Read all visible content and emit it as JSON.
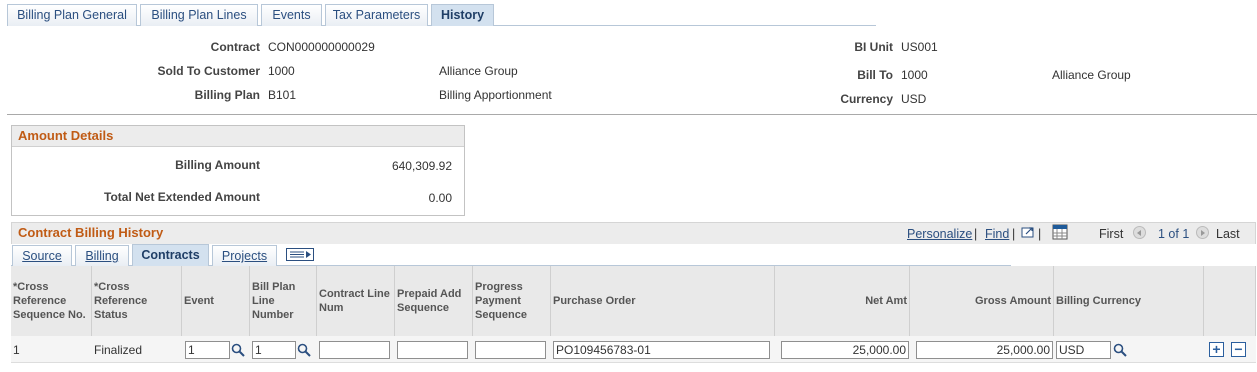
{
  "tabs": [
    "Billing Plan General",
    "Billing Plan Lines",
    "Events",
    "Tax Parameters",
    "History"
  ],
  "header": {
    "contract_label": "Contract",
    "contract_value": "CON000000000029",
    "bi_unit_label": "BI Unit",
    "bi_unit_value": "US001",
    "sold_to_label": "Sold To Customer",
    "sold_to_value": "1000",
    "sold_to_name": "Alliance Group",
    "bill_to_label": "Bill To",
    "bill_to_value": "1000",
    "bill_to_name": "Alliance Group",
    "billing_plan_label": "Billing Plan",
    "billing_plan_value": "B101",
    "billing_plan_desc": "Billing Apportionment",
    "currency_label": "Currency",
    "currency_value": "USD"
  },
  "amount_details": {
    "title": "Amount Details",
    "billing_amount_label": "Billing Amount",
    "billing_amount_value": "640,309.92",
    "total_net_label": "Total Net Extended Amount",
    "total_net_value": "0.00"
  },
  "grid": {
    "title": "Contract Billing History",
    "personalize": "Personalize",
    "find": "Find",
    "first": "First",
    "range": "1 of 1",
    "last": "Last",
    "subtabs": [
      "Source",
      "Billing",
      "Contracts",
      "Projects"
    ],
    "columns": [
      "*Cross Reference Sequence No.",
      "*Cross Reference Status",
      "Event",
      "Bill Plan Line Number",
      "Contract Line Num",
      "Prepaid Add Sequence",
      "Progress Payment Sequence",
      "Purchase Order",
      "Net Amt",
      "Gross Amount",
      "Billing Currency"
    ],
    "row": {
      "seq": "1",
      "status": "Finalized",
      "event": "1",
      "bill_plan_line": "1",
      "contract_line": "",
      "prepaid_add": "",
      "progress_payment": "",
      "purchase_order": "PO109456783-01",
      "net_amt": "25,000.00",
      "gross_amount": "25,000.00",
      "billing_currency": "USD"
    }
  },
  "colors": {
    "accent": "#c05b15",
    "link": "#2b4f80",
    "tab_active": "#d3e1ef"
  },
  "icons": [
    "lookup-icon",
    "zoom-icon",
    "download-icon",
    "show-all-columns-icon",
    "previous-icon",
    "next-icon",
    "add-row-icon",
    "delete-row-icon"
  ]
}
